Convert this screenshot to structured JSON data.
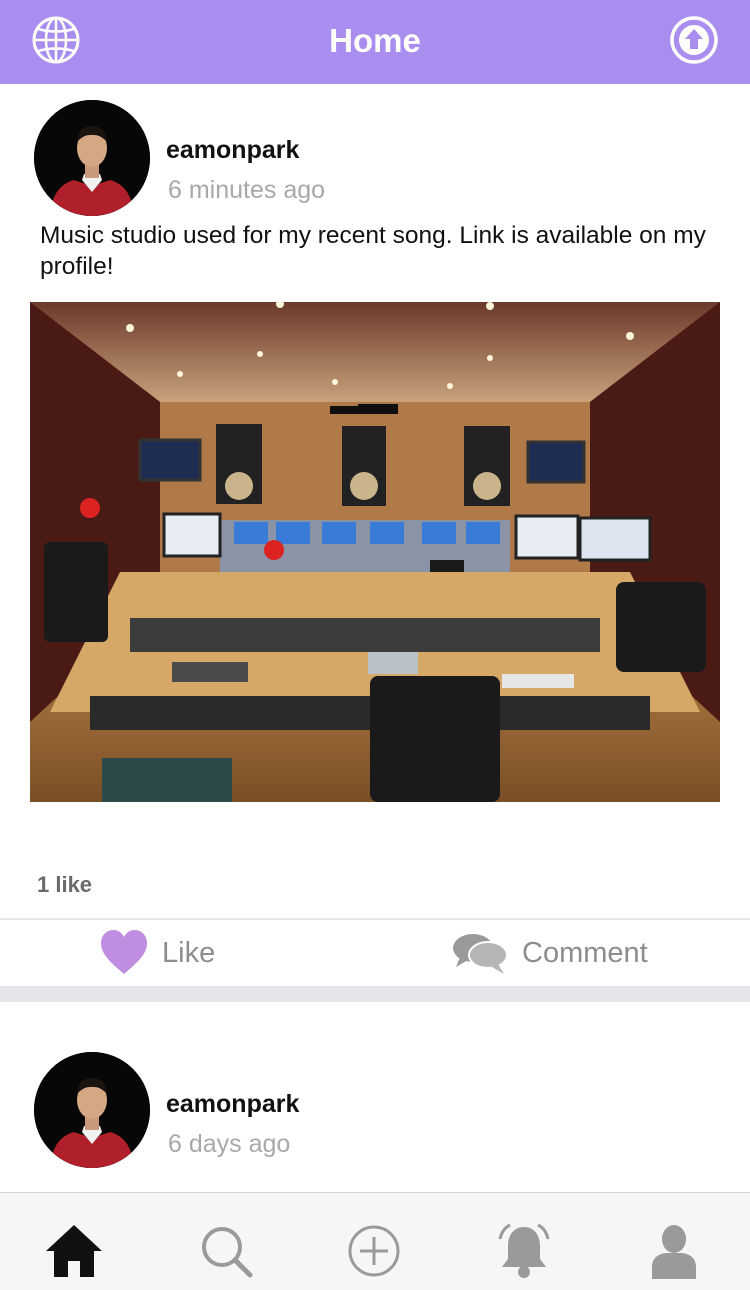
{
  "header": {
    "title": "Home",
    "left_icon": "globe-icon",
    "right_icon": "upload-arrow-icon",
    "color": "#a98ef0"
  },
  "posts": [
    {
      "username": "eamonpark",
      "time": "6 minutes ago",
      "caption": "Music studio used for my recent song. Link is available on my profile!",
      "likes": "1 like",
      "like_label": "Like",
      "comment_label": "Comment"
    },
    {
      "username": "eamonpark",
      "time": "6 days ago"
    }
  ],
  "tabs": [
    {
      "icon": "home-icon",
      "active": true
    },
    {
      "icon": "search-icon",
      "active": false
    },
    {
      "icon": "add-circle-icon",
      "active": false
    },
    {
      "icon": "bell-icon",
      "active": false
    },
    {
      "icon": "profile-icon",
      "active": false
    }
  ],
  "colors": {
    "like_heart": "#c08ee0",
    "muted_text": "#a8a8a8",
    "tab_active": "#111111",
    "tab_inactive": "#9a9a9a"
  }
}
